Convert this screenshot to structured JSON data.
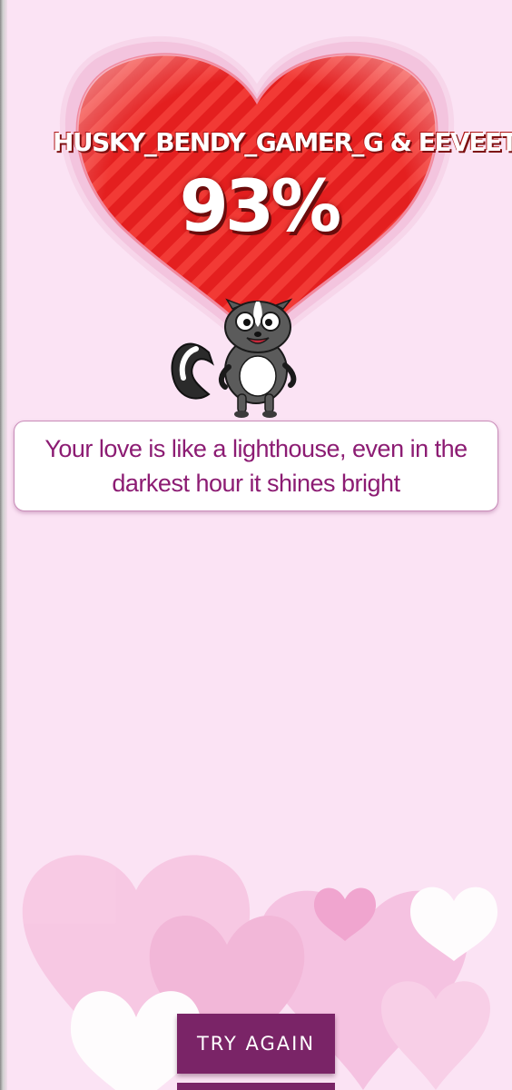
{
  "result": {
    "names": "HUSKY_BENDY_GAMER_G & EEVEETAKESAHIK",
    "percent": "93%",
    "message": "Your love is like a lighthouse, even in the darkest hour it shines bright"
  },
  "actions": {
    "try_again_label": "TRY AGAIN"
  },
  "theme": {
    "background": "#fbe3f4",
    "heart_red": "#e21d1d",
    "message_color": "#8c1c73",
    "button_color": "#7a2467"
  },
  "icons": {
    "heart": "heart-icon",
    "mascot": "skunk-mascot-icon"
  }
}
